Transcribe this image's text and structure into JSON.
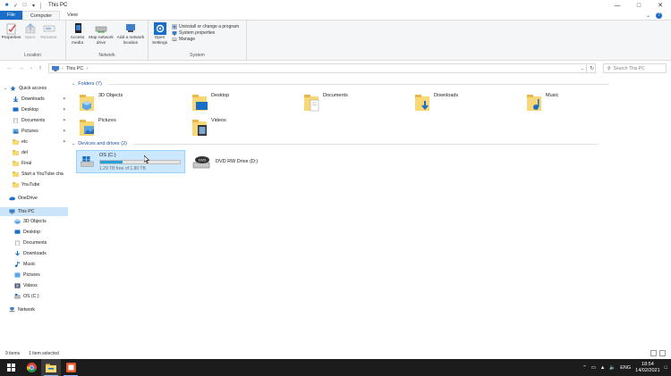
{
  "window": {
    "title": "This PC"
  },
  "ribbon_tabs": [
    {
      "label": "File"
    },
    {
      "label": "Computer"
    },
    {
      "label": "View"
    }
  ],
  "ribbon": {
    "location": {
      "label": "Location",
      "buttons": [
        "Properties",
        "Open",
        "Rename"
      ]
    },
    "network": {
      "label": "Network",
      "buttons": [
        "Access media",
        "Map network drive",
        "Add a network location"
      ]
    },
    "system": {
      "label": "System",
      "open_settings": "Open Settings",
      "items": [
        "Uninstall or change a program",
        "System properties",
        "Manage"
      ]
    }
  },
  "address": {
    "path": "This PC",
    "search_placeholder": "Search This PC"
  },
  "nav_pane": {
    "quick_access": "Quick access",
    "quick_items": [
      {
        "label": "Downloads"
      },
      {
        "label": "Desktop"
      },
      {
        "label": "Documents"
      },
      {
        "label": "Pictures"
      },
      {
        "label": "etc"
      },
      {
        "label": "del"
      },
      {
        "label": "Final"
      },
      {
        "label": "Start a YouTube cha"
      },
      {
        "label": "YouTube"
      }
    ],
    "onedrive": "OneDrive",
    "this_pc": "This PC",
    "pc_items": [
      {
        "label": "3D Objects"
      },
      {
        "label": "Desktop"
      },
      {
        "label": "Documents"
      },
      {
        "label": "Downloads"
      },
      {
        "label": "Music"
      },
      {
        "label": "Pictures"
      },
      {
        "label": "Videos"
      },
      {
        "label": "OS (C:)"
      }
    ],
    "network": "Network"
  },
  "content": {
    "folders_header": "Folders (7)",
    "folders": [
      {
        "label": "3D Objects"
      },
      {
        "label": "Desktop"
      },
      {
        "label": "Documents"
      },
      {
        "label": "Downloads"
      },
      {
        "label": "Music"
      },
      {
        "label": "Pictures"
      },
      {
        "label": "Videos"
      }
    ],
    "devices_header": "Devices and drives (2)",
    "drives": [
      {
        "label": "OS (C:)",
        "free": "1.29 TB free of 1.80 TB",
        "used_fraction": 0.28
      },
      {
        "label": "DVD RW Drive (D:)"
      }
    ]
  },
  "status": {
    "items": "9 items",
    "selected": "1 item selected"
  },
  "taskbar": {
    "lang": "ENG",
    "time": "18:54",
    "date": "14/02/2021"
  },
  "colors": {
    "accent": "#1a6ec7",
    "selection": "#cce8ff",
    "folder": "#f8d775",
    "drive_bar": "#26a0da"
  }
}
